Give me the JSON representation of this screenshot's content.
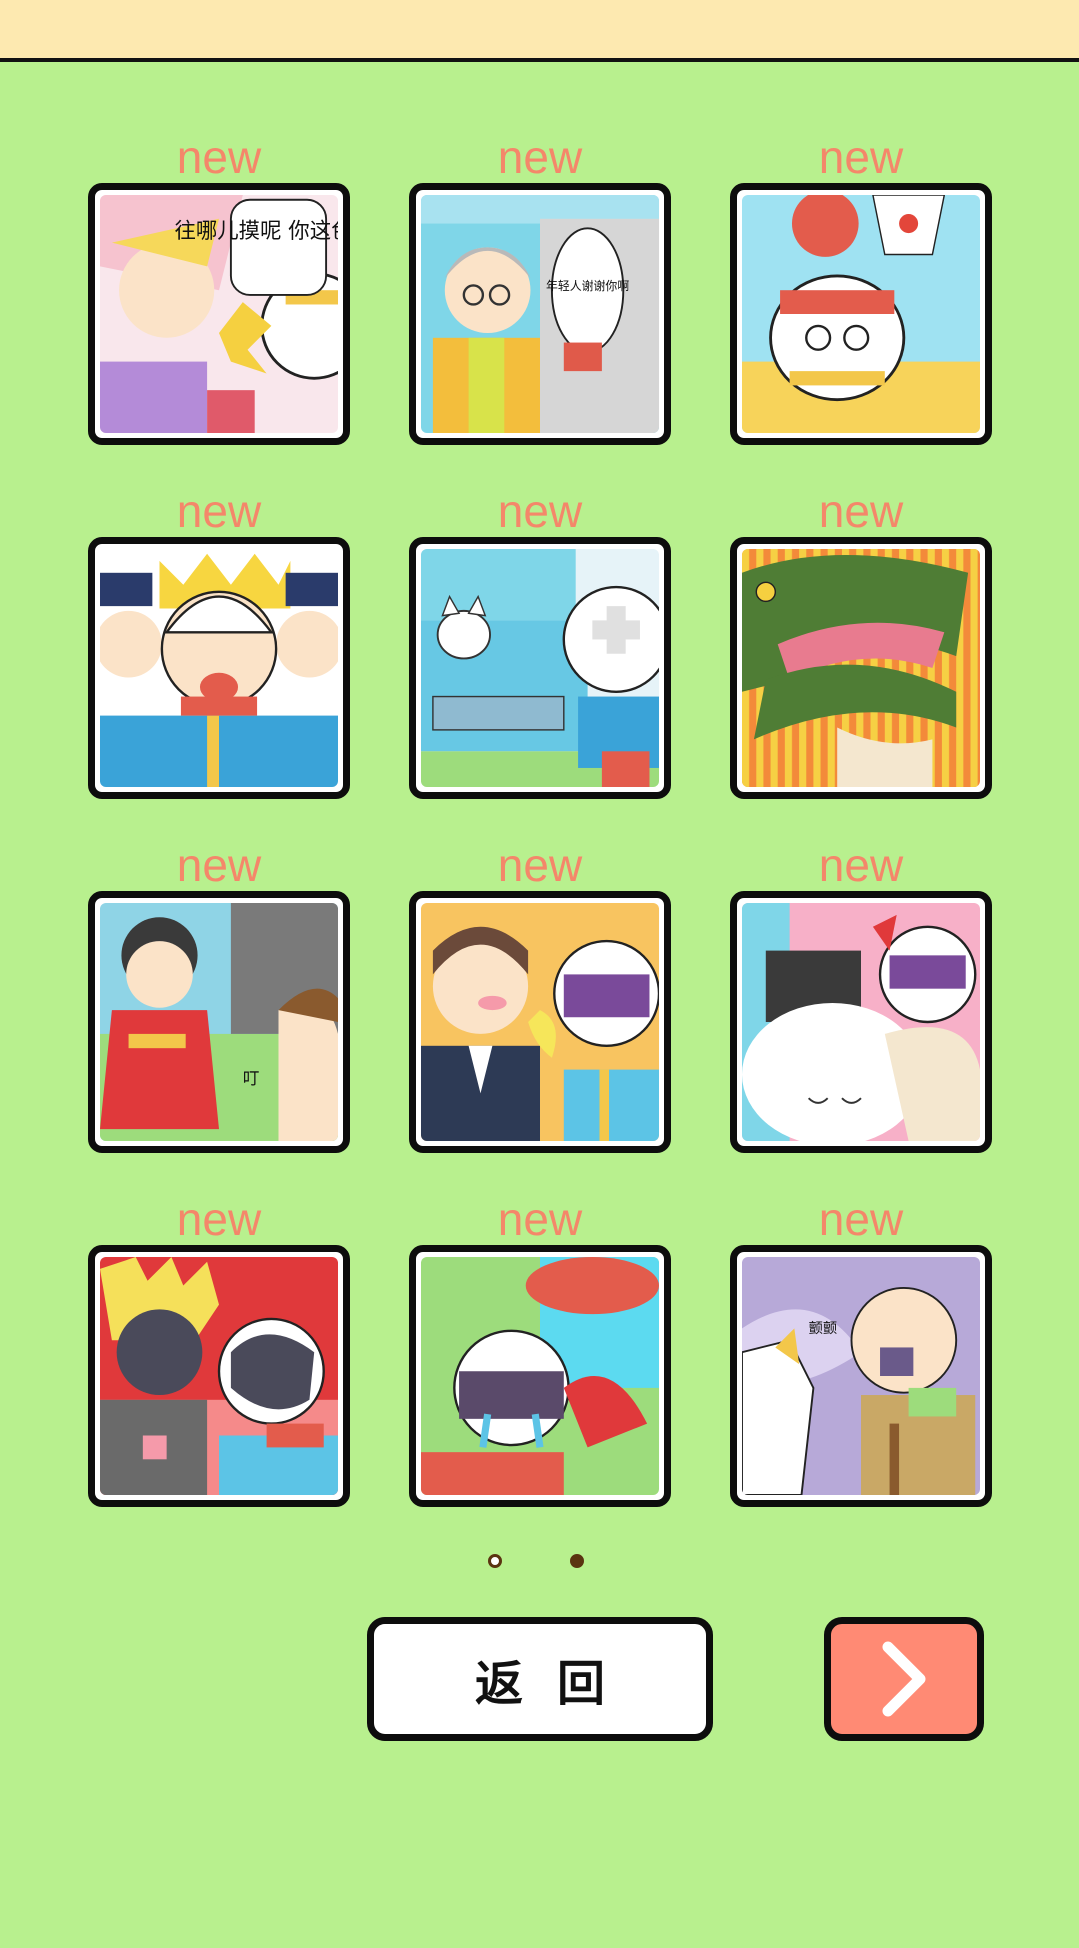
{
  "levels": [
    {
      "badge": "new",
      "thumb": "comic-woman-slap"
    },
    {
      "badge": "new",
      "thumb": "comic-grandma-thanks"
    },
    {
      "badge": "new",
      "thumb": "comic-dizzy-helmet"
    },
    {
      "badge": "new",
      "thumb": "comic-police"
    },
    {
      "badge": "new",
      "thumb": "comic-cat-car"
    },
    {
      "badge": "new",
      "thumb": "comic-crocodile"
    },
    {
      "badge": "new",
      "thumb": "comic-kimono"
    },
    {
      "badge": "new",
      "thumb": "comic-office-kiss"
    },
    {
      "badge": "new",
      "thumb": "comic-pink-hug"
    },
    {
      "badge": "new",
      "thumb": "comic-blonde-punk"
    },
    {
      "badge": "new",
      "thumb": "comic-crying-helmet"
    },
    {
      "badge": "new",
      "thumb": "comic-old-man"
    }
  ],
  "comic_text": {
    "panel1": "往哪儿摸呢 你这色狼!",
    "panel2": "年轻人谢谢你啊",
    "panel7": "叮",
    "panel12": "颤颤"
  },
  "pagination": {
    "pages": 2,
    "current": 2
  },
  "buttons": {
    "back_label": "返回",
    "next_icon": "chevron-right-icon"
  },
  "colors": {
    "background": "#b8f08e",
    "badge": "#f4876a",
    "next_button": "#ff8a74",
    "top_bar": "#fde9b0"
  }
}
